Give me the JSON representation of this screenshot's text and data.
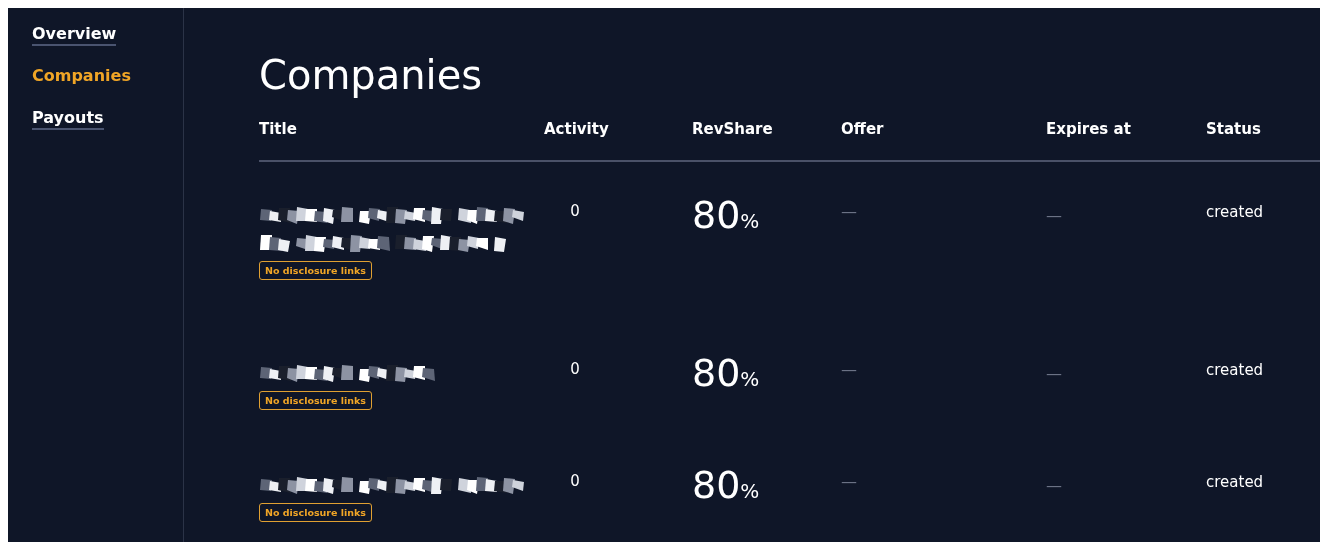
{
  "sidebar": {
    "items": [
      {
        "label": "Overview",
        "selected": false
      },
      {
        "label": "Companies",
        "selected": true
      },
      {
        "label": "Payouts",
        "selected": false
      }
    ]
  },
  "page": {
    "title": "Companies"
  },
  "table": {
    "columns": [
      "Title",
      "Activity",
      "RevShare",
      "Offer",
      "Expires at",
      "Status"
    ],
    "rows": [
      {
        "title": {
          "kind": "twoline"
        },
        "badge": "No disclosure links",
        "activity": "0",
        "revshare": "80",
        "revshare_unit": "%",
        "offer": "—",
        "expires_at": "—",
        "status": "created"
      },
      {
        "title": {
          "kind": "short"
        },
        "badge": "No disclosure links",
        "activity": "0",
        "revshare": "80",
        "revshare_unit": "%",
        "offer": "—",
        "expires_at": "—",
        "status": "created"
      },
      {
        "title": {
          "kind": "long"
        },
        "badge": "No disclosure links",
        "activity": "0",
        "revshare": "80",
        "revshare_unit": "%",
        "offer": "—",
        "expires_at": "—",
        "status": "created"
      }
    ]
  }
}
